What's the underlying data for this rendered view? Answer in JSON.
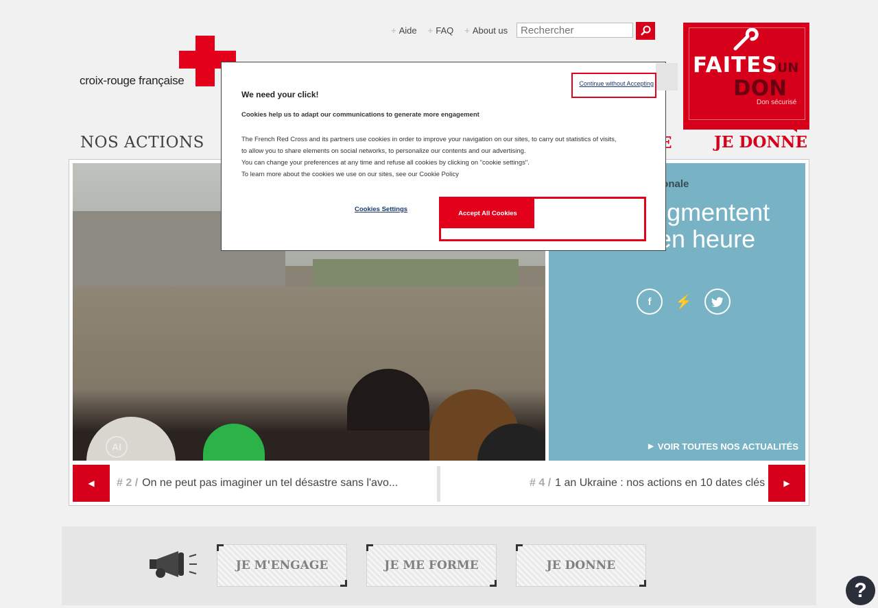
{
  "header": {
    "logo_text": "croix-rouge française",
    "links": [
      "Aide",
      "FAQ",
      "About us"
    ],
    "search_placeholder": "Rechercher",
    "donate": {
      "line1": "FAITES",
      "line2": "UN",
      "line3": "DON",
      "line4": "Don sécurisé"
    },
    "nav_left": "NOS ACTIONS",
    "nav_partial": "E",
    "nav_right": "JE DONNE"
  },
  "hero": {
    "watermark": "AI",
    "kicker": "tionale",
    "headline": "vi, les augmentent d'heure en heure",
    "see_all": "VOIR TOUTES NOS ACTUALITÉS",
    "prev_num": "# 2 /",
    "prev_title": "On ne peut pas imaginer un tel désastre sans l'avo...",
    "next_num": "# 4 /",
    "next_title": "1 an Ukraine : nos actions en 10 dates clés"
  },
  "cta": [
    "JE M'ENGAGE",
    "JE ME FORME",
    "JE DONNE"
  ],
  "help": "?",
  "cookie_dialog": {
    "close_label": "Continue without Accepting",
    "title": "We need your click!",
    "subtitle": "Cookies help us to adapt our communications to generate more engagement",
    "body": [
      "The French Red Cross and its partners use cookies in order to improve your navigation on our sites, to carry out statistics of visits,",
      "to allow you to share elements on social networks, to personalize our contents and our advertising.",
      "You can change your preferences at any time and refuse all cookies by clicking on \"cookie settings\".",
      "To learn more about the cookies we use on our sites, see our Cookie Policy"
    ],
    "settings_label": "Cookies Settings",
    "accept_label": "Accept All Cookies"
  },
  "colors": {
    "brand_red": "#d7001a",
    "panel_blue": "#77b3c4"
  }
}
